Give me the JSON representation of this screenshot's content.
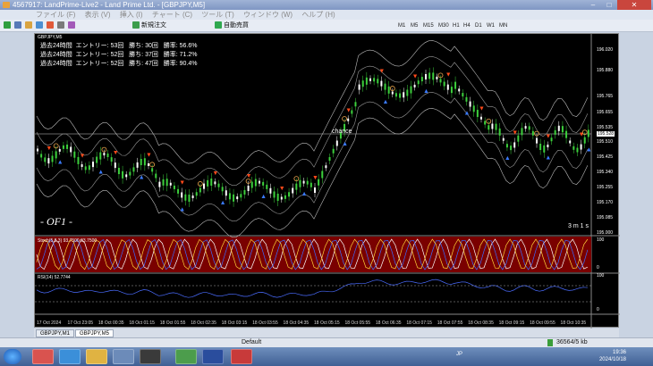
{
  "window": {
    "title": "4567917: LandPrime-Live2 - Land Prime Ltd. - [GBPJPY,M5]",
    "minimize": "–",
    "maximize": "□",
    "close": "✕"
  },
  "menu": [
    "ファイル (F)",
    "表示 (V)",
    "挿入 (I)",
    "チャート (C)",
    "ツール (T)",
    "ウィンドウ (W)",
    "ヘルプ (H)"
  ],
  "toolbar": {
    "new_order": "新規注文",
    "auto_trade": "自動売買",
    "timeframes": [
      "M1",
      "M5",
      "M15",
      "M30",
      "H1",
      "H4",
      "D1",
      "W1",
      "MN"
    ]
  },
  "chart": {
    "symbol_label": "GBPJPY,M5",
    "stats": [
      "過去24時間  エントリー: 53回   勝ち: 30回   勝率: 56.6%",
      "過去24時間  エントリー: 52回   勝ち: 37回   勝率: 71.2%",
      "過去24時間  エントリー: 52回   勝ち: 47回   勝率: 90.4%"
    ],
    "watermark": "- OF1 -",
    "countdown": "3 m 1 s",
    "chance_label": "chance",
    "price_axis": [
      "196.020",
      "195.880",
      "195.765",
      "195.655",
      "195.535",
      "195.510",
      "195.425",
      "195.340",
      "195.255",
      "195.170",
      "195.085",
      "195.000"
    ],
    "current_price": "195.528",
    "stoch_label": "Stoch(5,3,3) 93.7500 93.7500",
    "stoch_axis": [
      "100",
      "0"
    ],
    "rsi_label": "RSI(14) 52.7744",
    "rsi_axis": [
      "100",
      "0"
    ],
    "time_axis": [
      "17 Oct 2024",
      "17 Oct 23:05",
      "18 Oct 00:35",
      "18 Oct 01:15",
      "18 Oct 01:55",
      "18 Oct 02:35",
      "18 Oct 03:15",
      "18 Oct 03:55",
      "18 Oct 04:35",
      "18 Oct 05:15",
      "18 Oct 05:55",
      "18 Oct 06:35",
      "18 Oct 07:15",
      "18 Oct 07:55",
      "18 Oct 08:35",
      "18 Oct 09:15",
      "18 Oct 09:55",
      "18 Oct 10:35"
    ]
  },
  "tabs": [
    "GBPJPY,M1",
    "GBPJPY,M5"
  ],
  "status": {
    "profile": "Default",
    "traffic": "36564/5 kb"
  },
  "taskbar": {
    "time": "19:36",
    "date": "2024/10/18",
    "lang": "JP"
  },
  "colors": {
    "bull": "#3cd03c",
    "bear": "#ffffff",
    "up_arrow": "#3a7bff",
    "down_arrow": "#ff4a1a",
    "stoch_bg": "#7a0000"
  }
}
